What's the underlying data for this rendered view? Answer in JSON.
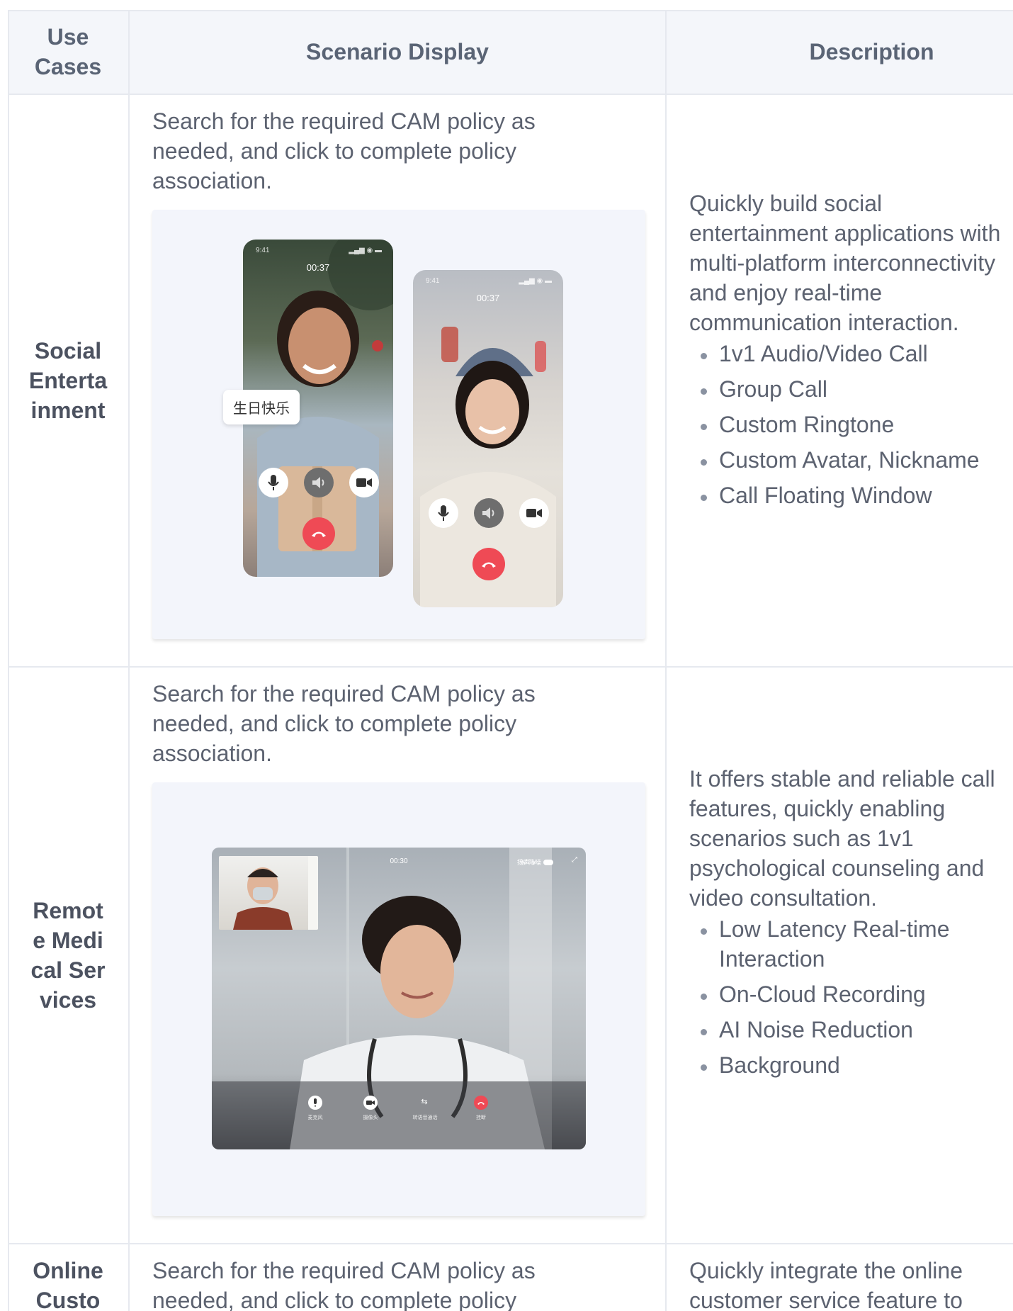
{
  "headers": {
    "use_cases": "Use Cases",
    "scenario_display": "Scenario Display",
    "description": "Description"
  },
  "rows": [
    {
      "use_case": "Social Entertainment",
      "scenario_text": "Search for the required CAM policy as needed, and click to complete policy association.",
      "description": "Quickly build social entertainment applications with multi-platform interconnectivity and enjoy real-time communication interaction.",
      "features": [
        "1v1 Audio/Video Call",
        "Group Call",
        "Custom Ringtone",
        "Custom Avatar, Nickname",
        "Call Floating Window"
      ],
      "phone_a": {
        "status_time": "9:41",
        "timer": "00:37",
        "bubble": "生日快乐"
      },
      "phone_b": {
        "status_time": "9:41",
        "timer": "00:37"
      }
    },
    {
      "use_case": "Remote Medical Services",
      "scenario_text": "Search for the required CAM policy as needed, and click to complete policy association.",
      "description": "It offers stable and reliable call features, quickly enabling scenarios such as 1v1 psychological counseling and video consultation.",
      "features": [
        "Low Latency Real-time Interaction",
        "On-Cloud Recording",
        "AI Noise Reduction",
        "Background"
      ],
      "tablet": {
        "timer": "00:30",
        "top_right_a": "扬声 ∨",
        "top_right_b": "AI 降噪",
        "labels": [
          "麦克风",
          "摄像头",
          "转语音通话",
          "挂断"
        ]
      }
    },
    {
      "use_case": "Online Custo",
      "scenario_text": "Search for the required CAM policy as needed, and click to complete policy",
      "description": "Quickly integrate the online customer service feature to"
    }
  ],
  "colors": {
    "accent_red": "#ef4a55",
    "border": "#e6e9ef",
    "header_bg": "#f4f6fa",
    "card_bg": "#f3f5fb"
  }
}
